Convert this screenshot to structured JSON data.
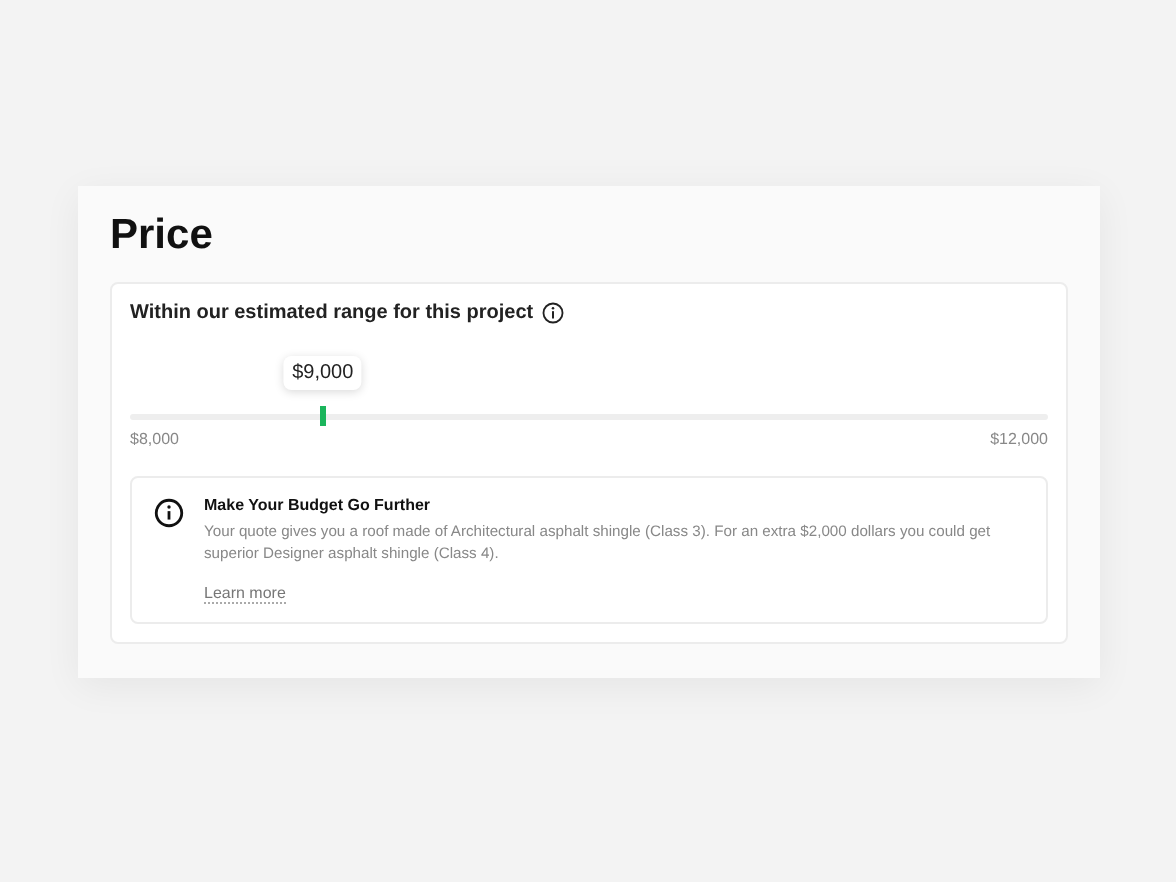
{
  "title": "Price",
  "range": {
    "label": "Within our estimated range for this project",
    "slider": {
      "level": 0.21,
      "value_label": "$9,000"
    },
    "min_label": "$8,000",
    "max_label": "$12,000"
  },
  "tip": {
    "heading": "Make Your Budget Go Further",
    "body": "Your quote gives you a roof made of Architectural asphalt shingle (Class 3). For an extra $2,000 dollars you could get superior Designer asphalt shingle (Class 4).",
    "link": "Learn more"
  }
}
